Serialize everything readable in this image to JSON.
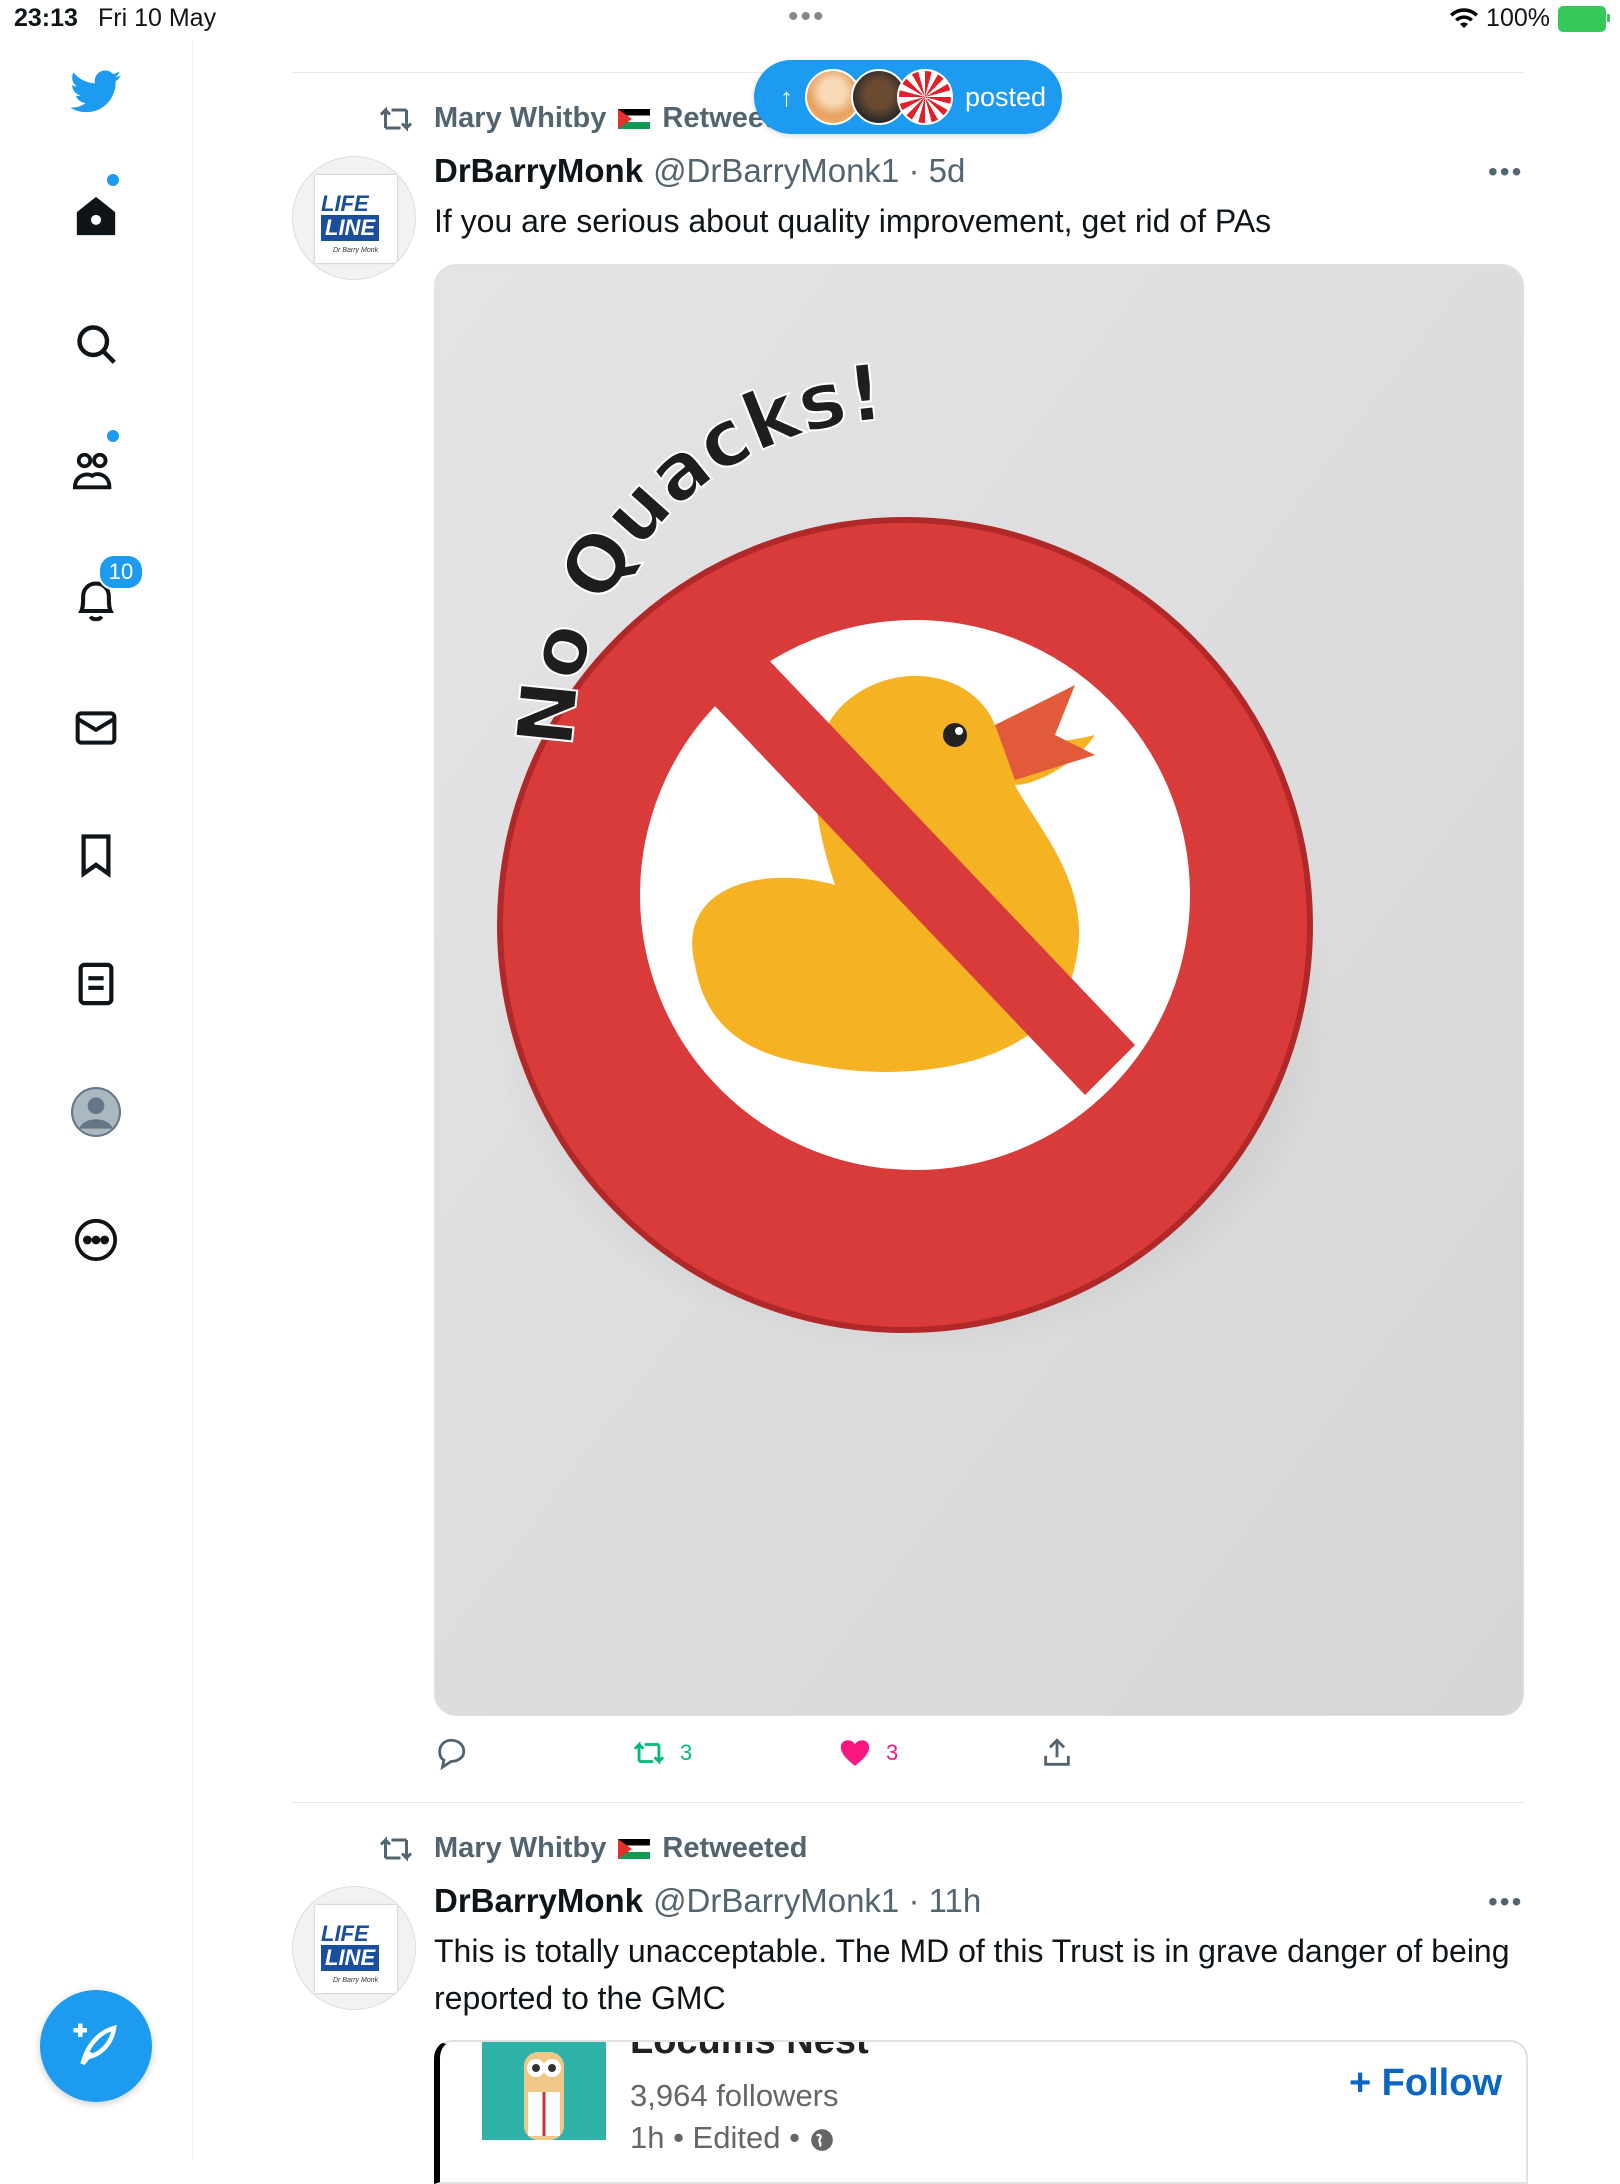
{
  "status_bar": {
    "time": "23:13",
    "date": "Fri 10 May",
    "battery": "100%"
  },
  "sidebar": {
    "items": [
      {
        "icon": "twitter-bird-icon"
      },
      {
        "icon": "home-icon",
        "has_dot": true
      },
      {
        "icon": "search-icon"
      },
      {
        "icon": "communities-icon",
        "has_dot": true
      },
      {
        "icon": "notifications-bell-icon",
        "badge": "10"
      },
      {
        "icon": "messages-envelope-icon"
      },
      {
        "icon": "bookmark-icon"
      },
      {
        "icon": "lists-icon"
      },
      {
        "icon": "profile-avatar-icon"
      },
      {
        "icon": "more-circle-icon"
      }
    ],
    "compose_icon": "compose-feather-icon"
  },
  "new_posts_pill": {
    "arrow": "↑",
    "label": "posted"
  },
  "tweets": [
    {
      "retweeted_by": "Mary Whitby",
      "retweeted_label": "Retweeted",
      "name": "DrBarryMonk",
      "handle": "@DrBarryMonk1 · 5d",
      "text": "If you are serious about quality improvement, get rid of PAs",
      "media_text": "No Quacks!",
      "actions": {
        "replies": "",
        "retweets": "3",
        "likes": "3"
      }
    },
    {
      "retweeted_by": "Mary Whitby",
      "retweeted_label": "Retweeted",
      "name": "DrBarryMonk",
      "handle": "@DrBarryMonk1 · 11h",
      "text": "This is totally unacceptable. The MD of this Trust is in grave danger of being reported to the GMC",
      "card": {
        "title": "Locums Nest",
        "followers": "3,964 followers",
        "meta": "1h • Edited •",
        "follow_label": "+ Follow"
      }
    }
  ],
  "avatar_logo": {
    "line1": "LIFE",
    "line2": "LINE",
    "author": "Dr Barry Monk"
  },
  "colors": {
    "brand": "#1d9bf0",
    "retweet": "#00ba7c",
    "like": "#f91880",
    "badge_red": "#d93a3a",
    "duck": "#f5b324"
  }
}
